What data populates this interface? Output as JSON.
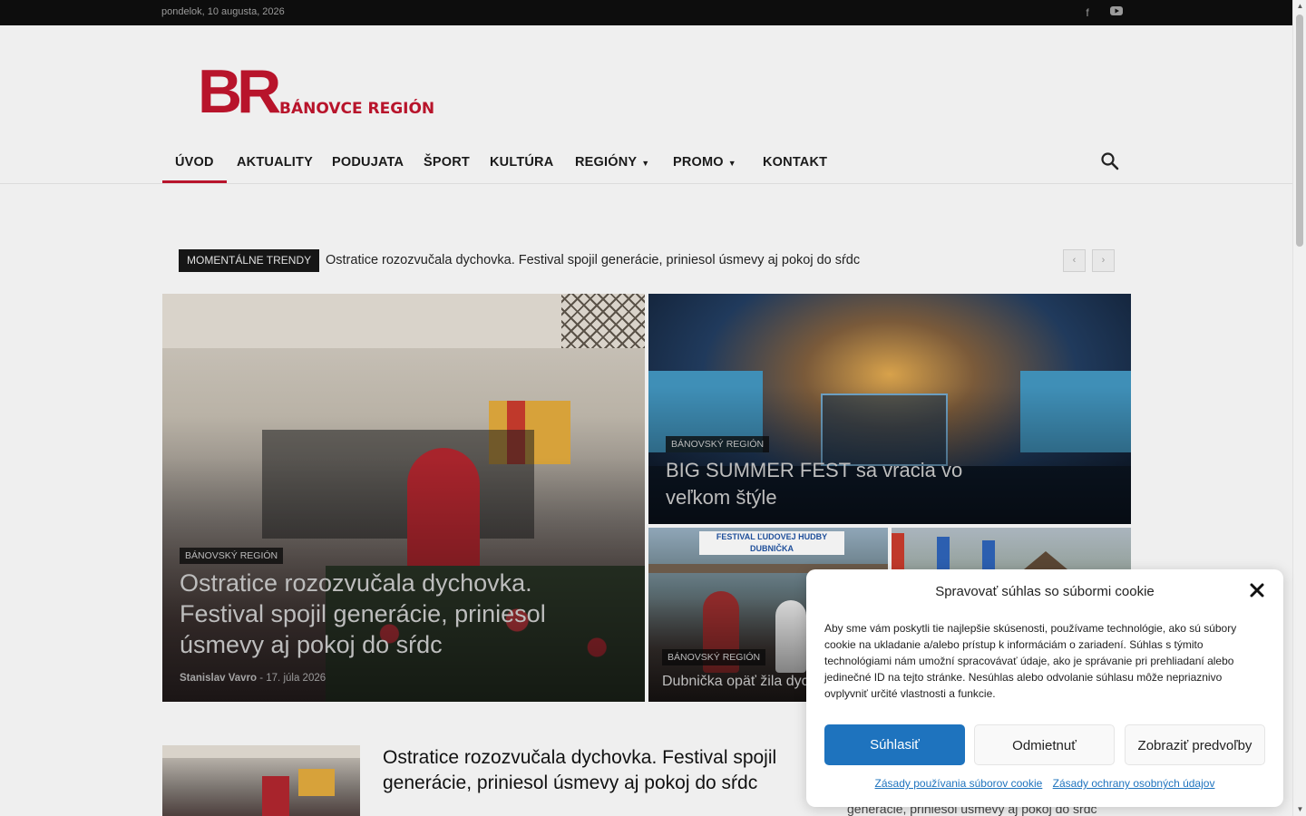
{
  "topbar": {
    "date": "pondelok, 10 augusta, 2026"
  },
  "header": {
    "logo_mark": "BR",
    "logo_name": "BÁNOVCE REGIÓN"
  },
  "nav": {
    "items": [
      {
        "label": "ÚVOD"
      },
      {
        "label": "AKTUALITY"
      },
      {
        "label": "PODUJATA"
      },
      {
        "label": "ŠPORT"
      },
      {
        "label": "KULTÚRA"
      },
      {
        "label": "REGIÓNY"
      },
      {
        "label": "PROMO"
      },
      {
        "label": "KONTAKT"
      }
    ]
  },
  "trending": {
    "badge": "MOMENTÁLNE TRENDY",
    "headline": "Ostratice rozozvučala dychovka. Festival spojil generácie, priniesol úsmevy aj pokoj do sŕdc"
  },
  "featured": [
    {
      "category": "BÁNOVSKÝ REGIÓN",
      "title": "Ostratice rozozvučala dychovka. Festival spojil generácie, priniesol úsmevy aj pokoj do sŕdc",
      "author": "Stanislav Vavro",
      "date": "17. júla 2026"
    },
    {
      "category": "BÁNOVSKÝ REGIÓN",
      "title": "BIG SUMMER FEST sa vracia vo veľkom štýle"
    },
    {
      "category": "BÁNOVSKÝ REGIÓN",
      "title": "Dubnička opäť žila dych",
      "banner": "FESTIVAL ĽUDOVEJ HUDBY DUBNIČKA"
    }
  ],
  "lower": {
    "title": "Ostratice rozozvučala dychovka. Festival spojil generácie, priniesol úsmevy aj pokoj do sŕdc",
    "right_snippet": "generácie, priniesol úsmevy aj pokoj do sŕdc"
  },
  "cookie": {
    "title": "Spravovať súhlas so súbormi cookie",
    "body": "Aby sme vám poskytli tie najlepšie skúsenosti, používame technológie, ako sú súbory cookie na ukladanie a/alebo prístup k informáciám o zariadení. Súhlas s týmito technológiami nám umožní spracovávať údaje, ako je správanie pri prehliadaní alebo jedinečné ID na tejto stránke. Nesúhlas alebo odvolanie súhlasu môže nepriaznivo ovplyvniť určité vlastnosti a funkcie.",
    "accept": "Súhlasiť",
    "deny": "Odmietnuť",
    "prefs": "Zobraziť predvoľby",
    "link_cookies": "Zásady používania súborov cookie",
    "link_privacy": "Zásady ochrany osobných údajov"
  },
  "colors": {
    "brand": "#b8142b",
    "accept": "#1e73be"
  }
}
